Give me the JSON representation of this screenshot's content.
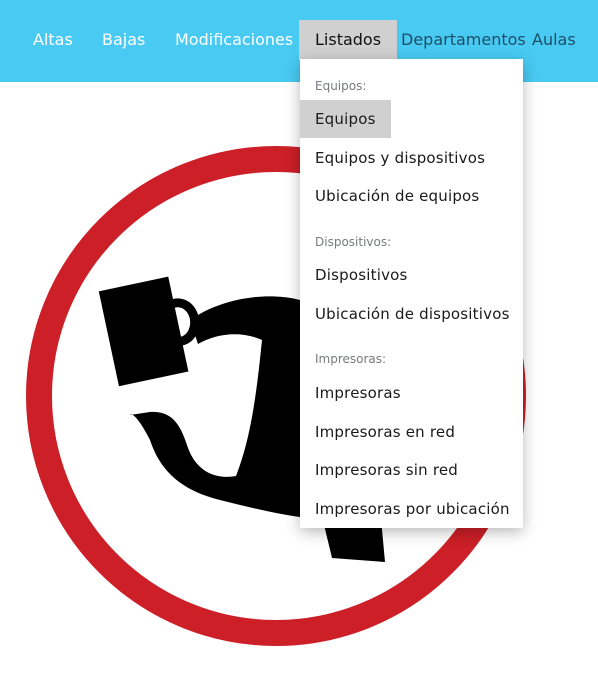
{
  "nav": {
    "items": [
      {
        "label": "Altas"
      },
      {
        "label": "Bajas"
      },
      {
        "label": "Modificaciones"
      },
      {
        "label": "Listados"
      },
      {
        "label": "Departamentos"
      },
      {
        "label": "Aulas"
      }
    ]
  },
  "dropdown": {
    "groups": [
      {
        "header": "Equipos:",
        "items": [
          "Equipos",
          "Equipos y dispositivos",
          "Ubicación de equipos"
        ]
      },
      {
        "header": "Dispositivos:",
        "items": [
          "Dispositivos",
          "Ubicación de dispositivos"
        ]
      },
      {
        "header": "Impresoras:",
        "items": [
          "Impresoras",
          "Impresoras en red",
          "Impresoras sin red",
          "Impresoras por ubicación"
        ]
      }
    ],
    "selected_item": "Equipos"
  },
  "colors": {
    "navbar": "#48caf3",
    "active_tab": "#d0d0d0",
    "sign_red": "#cc1f27",
    "sign_black": "#000000"
  },
  "hero": {
    "icon": "no-hitchhiking-sign-icon"
  }
}
